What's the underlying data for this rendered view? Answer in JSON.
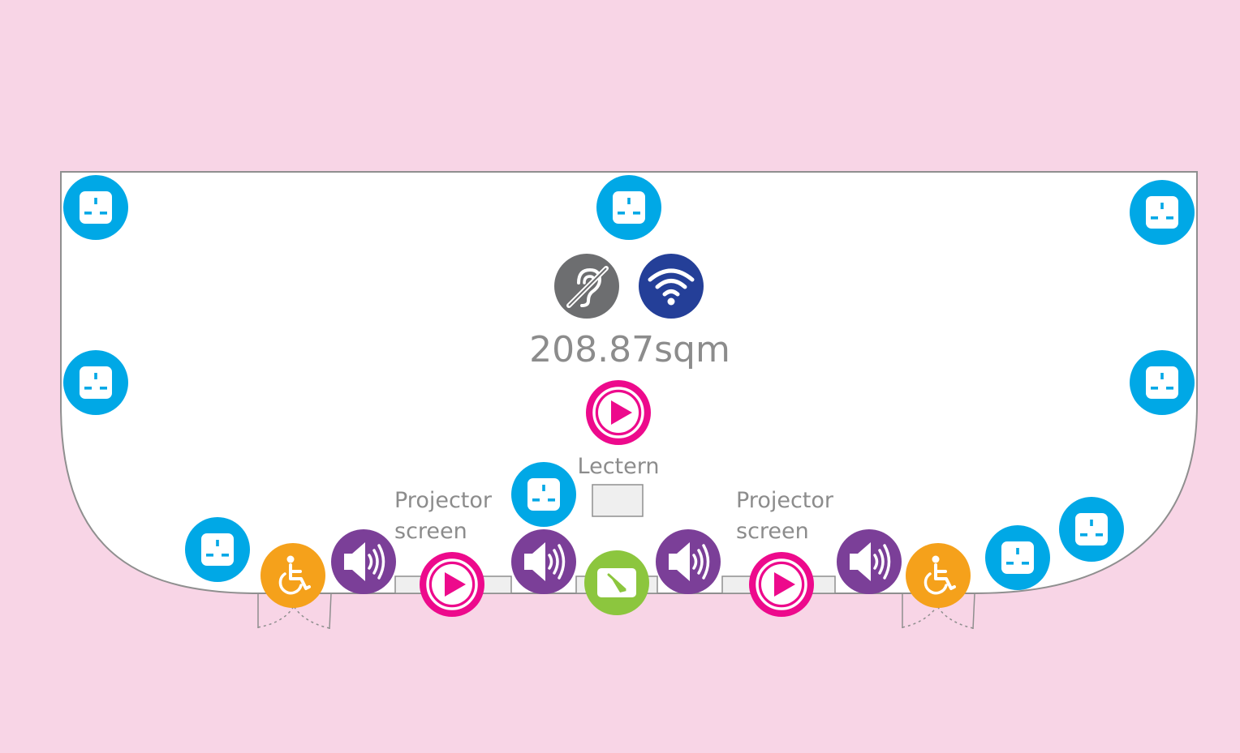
{
  "floor_plan": {
    "area": "208.87sqm",
    "labels": {
      "lectern": "Lectern",
      "projector_screen_left": [
        "Projector",
        "screen"
      ],
      "projector_screen_right": [
        "Projector",
        "screen"
      ]
    }
  },
  "colors": {
    "background": "#f8d5e6",
    "room_fill": "#ffffff",
    "wall": "#8f8f8f",
    "power": "#00a8e6",
    "hearing_loop": "#6d6e70",
    "wifi": "#243f98",
    "av": "#ed0a8c",
    "speaker": "#7b3f98",
    "accessible": "#f5a11b",
    "whiteboard": "#8cc63e",
    "furniture": "#efefef"
  },
  "icons": {
    "power": "power-socket-icon",
    "hearing_loop": "hearing-loop-icon",
    "wifi": "wifi-icon",
    "av": "play-icon",
    "speaker": "speaker-icon",
    "accessible": "wheelchair-icon",
    "whiteboard": "whiteboard-icon"
  }
}
